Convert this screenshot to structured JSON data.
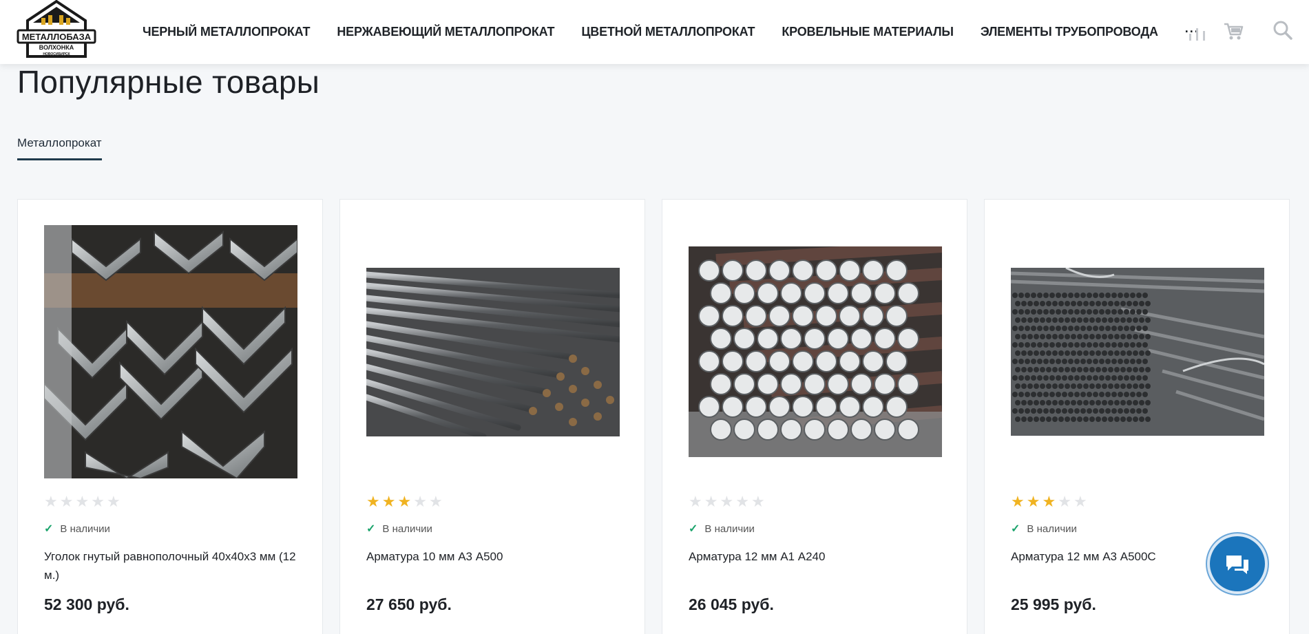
{
  "header": {
    "logo_text": [
      "МЕТАЛЛОБАЗА",
      "ВОЛХОНКА",
      "НОВОСИБИРСК"
    ],
    "nav": [
      {
        "label": "ЧЕРНЫЙ МЕТАЛЛОПРОКАТ"
      },
      {
        "label": "НЕРЖАВЕЮЩИЙ МЕТАЛЛОПРОКАТ"
      },
      {
        "label": "ЦВЕТНОЙ МЕТАЛЛОПРОКАТ"
      },
      {
        "label": "КРОВЕЛЬНЫЕ МАТЕРИАЛЫ"
      },
      {
        "label": "ЭЛЕМЕНТЫ ТРУБОПРОВОДА"
      }
    ],
    "more_label": "···",
    "icons": [
      "compare-icon",
      "cart-icon",
      "search-icon"
    ]
  },
  "main": {
    "title": "Популярные товары",
    "tabs": [
      {
        "label": "Металлопрокат",
        "active": true
      }
    ],
    "products": [
      {
        "rating": 0,
        "stock": "В наличии",
        "name": "Уголок гнутый равнополочный 40х40х3 мм (12 м.)",
        "price": "52 300 руб.",
        "image": "angle-steel"
      },
      {
        "rating": 3,
        "stock": "В наличии",
        "name": "Арматура 10 мм А3 А500",
        "price": "27 650 руб.",
        "image": "rebar-bundle"
      },
      {
        "rating": 0,
        "stock": "В наличии",
        "name": "Арматура 12 мм А1 А240",
        "price": "26 045 руб.",
        "image": "round-bar-ends"
      },
      {
        "rating": 3,
        "stock": "В наличии",
        "name": "Арматура 12 мм А3 А500С",
        "price": "25 995 руб.",
        "image": "rebar-stack"
      }
    ]
  },
  "colors": {
    "star_on": "#f0b321",
    "star_off": "#e1e3e6",
    "stock_check": "#1aa36b",
    "chat": "#1b75bc",
    "tab_underline": "#1e3a4c"
  },
  "chat": {
    "icon": "chat-icon"
  }
}
